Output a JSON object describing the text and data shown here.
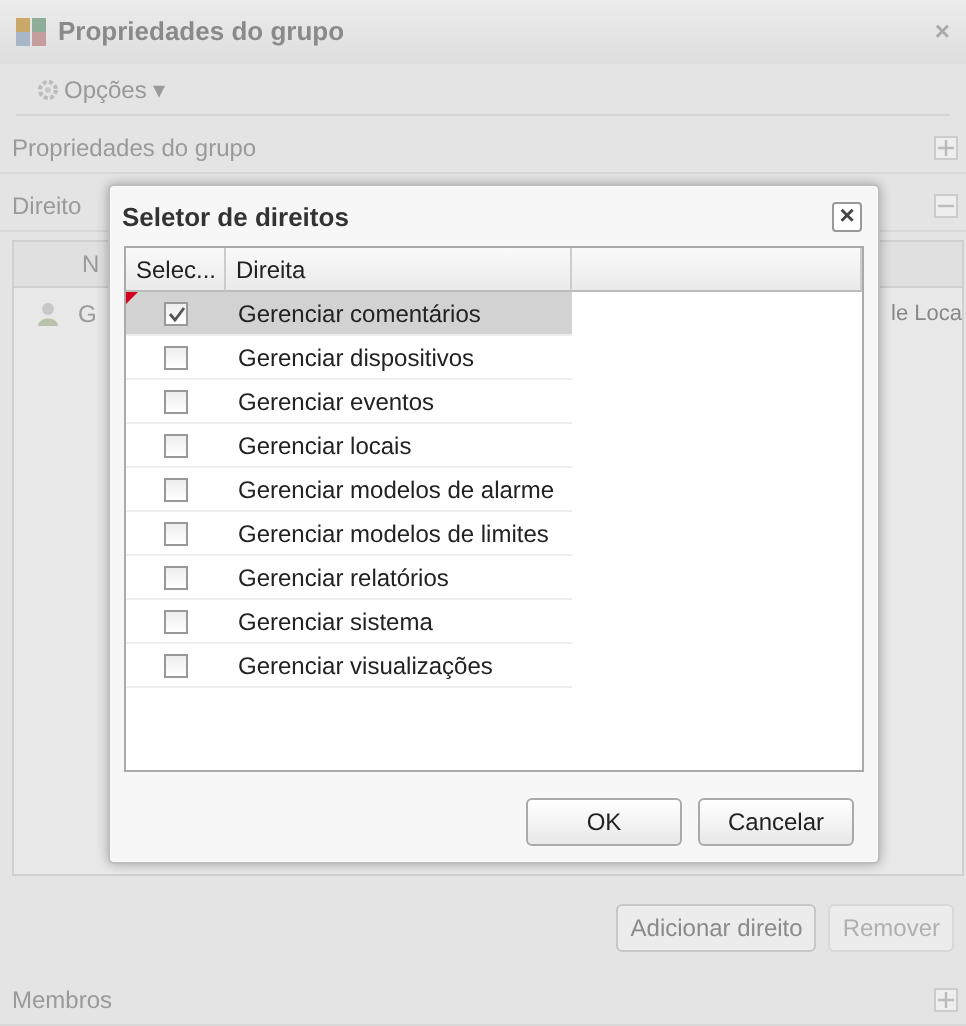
{
  "window": {
    "title": "Propriedades do grupo",
    "close": "×"
  },
  "toolbar": {
    "options_menu": "Opções ▾"
  },
  "sections": [
    {
      "title": "Propriedades do grupo",
      "expanded": false
    },
    {
      "title": "Direito",
      "expanded": true
    }
  ],
  "rights_table": {
    "column_1": "N",
    "row": {
      "cell_1": "G",
      "cell_2": "le Loca"
    }
  },
  "buttons": [
    {
      "label": "Adicionar direito",
      "disabled": false
    },
    {
      "label": "Remover",
      "disabled": true
    }
  ],
  "members_section": {
    "title": "Membros",
    "expanded": false
  },
  "dialog": {
    "title": "Seletor de direitos",
    "close": "×",
    "columns": [
      "Selec...",
      "Direita"
    ],
    "rows": [
      {
        "label": "Gerenciar comentários",
        "checked": true,
        "selected": true,
        "modified": true
      },
      {
        "label": "Gerenciar dispositivos",
        "checked": false,
        "selected": false,
        "modified": false
      },
      {
        "label": "Gerenciar eventos",
        "checked": false,
        "selected": false,
        "modified": false
      },
      {
        "label": "Gerenciar locais",
        "checked": false,
        "selected": false,
        "modified": false
      },
      {
        "label": "Gerenciar modelos de alarme",
        "checked": false,
        "selected": false,
        "modified": false
      },
      {
        "label": "Gerenciar modelos de limites",
        "checked": false,
        "selected": false,
        "modified": false
      },
      {
        "label": "Gerenciar relatórios",
        "checked": false,
        "selected": false,
        "modified": false
      },
      {
        "label": "Gerenciar sistema",
        "checked": false,
        "selected": false,
        "modified": false
      },
      {
        "label": "Gerenciar visualizações",
        "checked": false,
        "selected": false,
        "modified": false
      }
    ],
    "buttons": [
      "OK",
      "Cancelar"
    ]
  }
}
